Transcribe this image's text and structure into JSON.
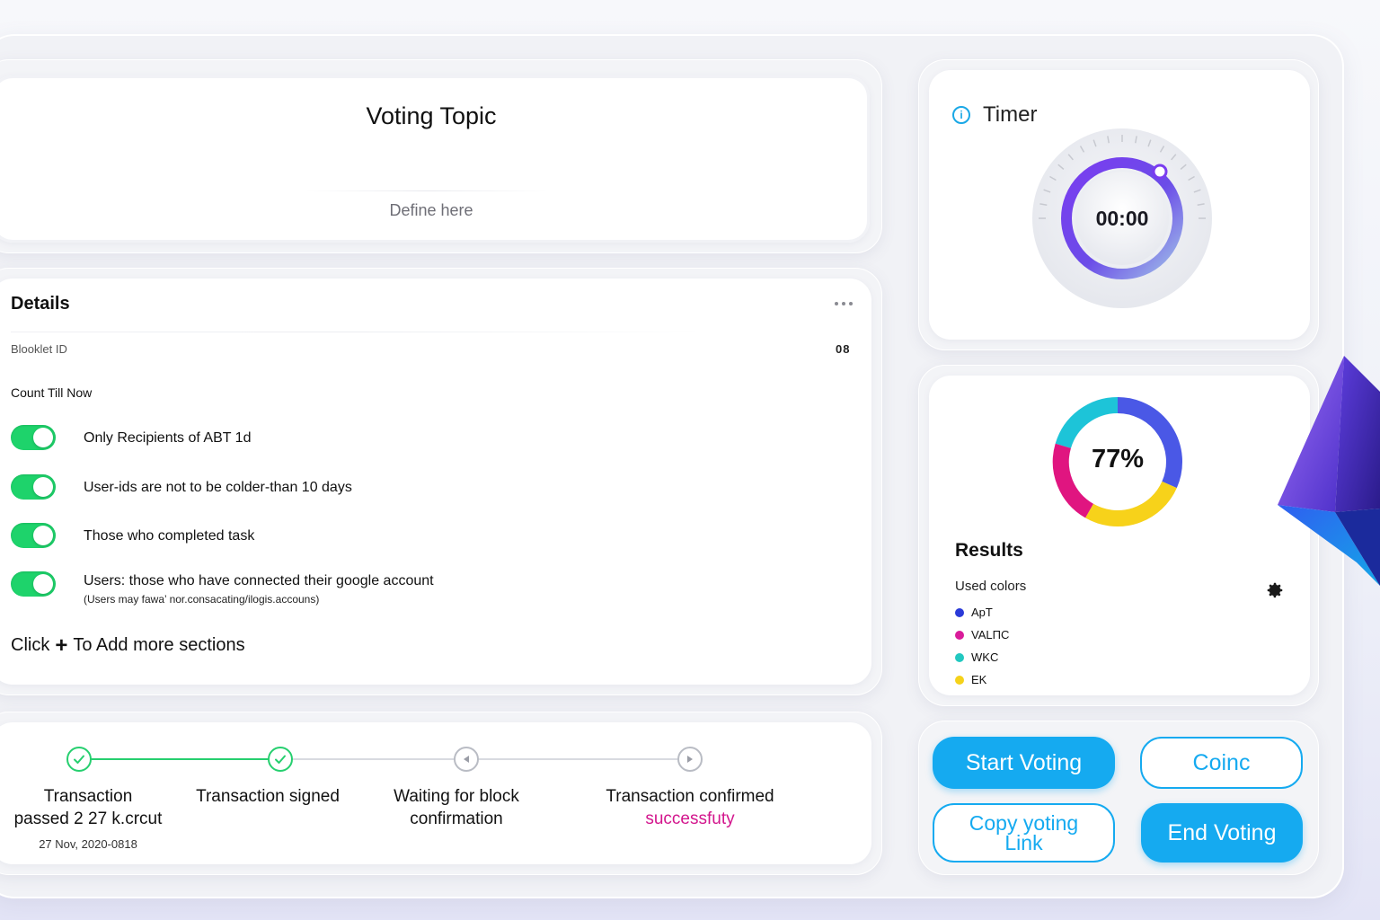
{
  "topic": {
    "title": "Voting Topic",
    "placeholder": "Define here"
  },
  "details": {
    "title": "Details",
    "booklet_id_label": "Blooklet ID",
    "booklet_id_value": "08",
    "count_label": "Count Till Now",
    "rules": [
      {
        "label": "Only Recipients of ABT 1d",
        "enabled": true
      },
      {
        "label": "User-ids are not to be colder-than 10 days",
        "enabled": true
      },
      {
        "label": "Those who completed task",
        "enabled": true
      },
      {
        "label": "Users: those who have connected their google account",
        "enabled": true
      }
    ],
    "rule_note": "(Users may fawa’ nor.consacating/ilogis.accouns)",
    "add_prefix": "Click",
    "add_suffix": "To Add more sections"
  },
  "progress": {
    "steps": [
      {
        "label_line1": "Transaction",
        "label_line2": "passed 2 27 k.crcut",
        "status": "done"
      },
      {
        "label_line1": "Transaction signed",
        "label_line2": "",
        "status": "done"
      },
      {
        "label_line1": "Waiting for block",
        "label_line2": "confirmation",
        "status": "pending"
      },
      {
        "label_line1": "Transaction confirmed",
        "label_line2": "successfuty",
        "status": "pending"
      }
    ],
    "date": "27 Nov, 2020-0818"
  },
  "timer": {
    "title": "Timer",
    "value": "00:00"
  },
  "results": {
    "percent_label": "77%",
    "title": "Results",
    "used_colors_label": "Used colors",
    "legend": [
      {
        "label": "ApT",
        "color": "#2a3ad8"
      },
      {
        "label": "VALΠC",
        "color": "#d91c9a"
      },
      {
        "label": "WKC",
        "color": "#22c8c0"
      },
      {
        "label": "EK",
        "color": "#f5d21a"
      }
    ]
  },
  "buttons": {
    "start": "Start Voting",
    "coinc": "Coinc",
    "copy_line1": "Copy yoting",
    "copy_line2": "Link",
    "end": "End Voting"
  },
  "colors": {
    "accent": "#15aaf0",
    "toggle": "#1ed36b",
    "success": "#d3168d"
  }
}
